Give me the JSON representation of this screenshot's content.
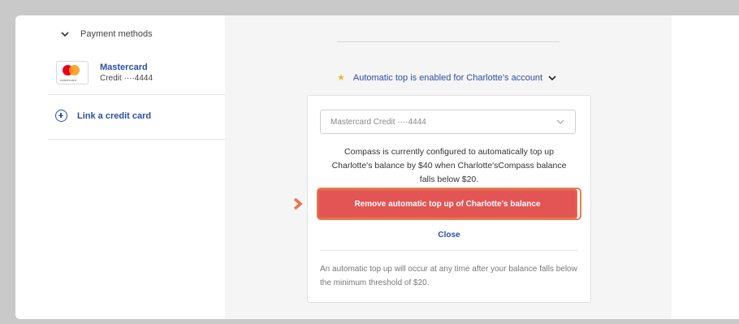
{
  "sidebar": {
    "payment_methods_label": "Payment methods",
    "card": {
      "name": "Mastercard",
      "number": "Credit ····4444",
      "logo_text": "mastercard"
    },
    "link_card_label": "Link a credit card"
  },
  "main": {
    "auto_topup_status": "Automatic top is enabled for Charlotte's account",
    "panel": {
      "selected_payment": "Mastercard Credit ····4444",
      "description_line1": "Compass is currently configured to automatically top up",
      "description_line2": "Charlotte's balance by $40 when Charlotte'sCompass balance",
      "description_line3": "falls below $20.",
      "remove_button_label": "Remove automatic top up of Charlotte's balance",
      "close_label": "Close",
      "note": "An automatic top up will occur at any time after your balance falls below the minimum threshold of $20."
    }
  },
  "colors": {
    "accent_blue": "#2a4fa8",
    "remove_red": "#e35454",
    "highlight_orange": "#e87a50",
    "star_yellow": "#f1b52c"
  },
  "icons": [
    "chevron-down-icon",
    "mastercard-logo",
    "plus-circle-icon",
    "star-icon",
    "arrow-right-icon"
  ]
}
